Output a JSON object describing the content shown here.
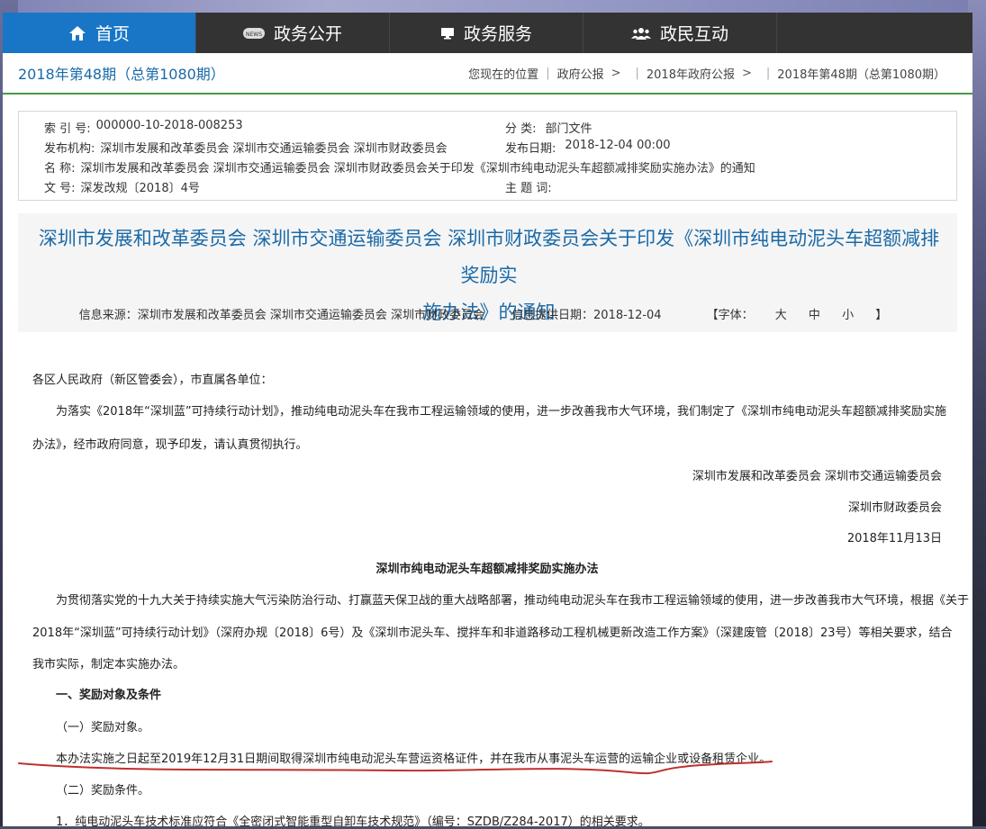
{
  "nav": {
    "items": [
      {
        "label": "首页",
        "icon": "home-icon"
      },
      {
        "label": "政务公开",
        "icon": "news-icon"
      },
      {
        "label": "政务服务",
        "icon": "monitor-icon"
      },
      {
        "label": "政民互动",
        "icon": "users-icon"
      }
    ],
    "news_badge": "NEWS"
  },
  "issue": "2018年第48期（总第1080期）",
  "breadcrumb": {
    "location_label": "您现在的位置",
    "items": [
      "政府公报",
      "2018年政府公报",
      "2018年第48期（总第1080期）"
    ],
    "separator": ">"
  },
  "info": {
    "index_label": "索 引 号:",
    "index_value": "000000-10-2018-008253",
    "category_label": "分 类:",
    "category_value": "部门文件",
    "org_label": "发布机构:",
    "org_value": "深圳市发展和改革委员会 深圳市交通运输委员会 深圳市财政委员会",
    "date_label": "发布日期:",
    "date_value": "2018-12-04 00:00",
    "name_label": "名 称:",
    "name_value": "深圳市发展和改革委员会 深圳市交通运输委员会 深圳市财政委员会关于印发《深圳市纯电动泥头车超额减排奖励实施办法》的通知",
    "docno_label": "文 号:",
    "docno_value": "深发改规〔2018〕4号",
    "keywords_label": "主 题 词:",
    "keywords_value": ""
  },
  "title": {
    "line1": "深圳市发展和改革委员会 深圳市交通运输委员会 深圳市财政委员会关于印发《深圳市纯电动泥头车超额减排奖励实",
    "line2": "施办法》的通知"
  },
  "meta": {
    "source": "信息来源：深圳市发展和改革委员会 深圳市交通运输委员会 深圳市财政委员会",
    "provided": "信息提供日期：2018-12-04",
    "font_open": "【字体：",
    "font_large": "大",
    "font_medium": "中",
    "font_small": "小",
    "font_close": "】"
  },
  "body": {
    "salutation": "各区人民政府（新区管委会），市直属各单位：",
    "para1_line1": "为落实《2018年“深圳蓝”可持续行动计划》，推动纯电动泥头车在我市工程运输领域的使用，进一步改善我市大气环境，我们制定了《深圳市纯电动泥头车超额减排奖励实施",
    "para1_line2": "办法》，经市政府同意，现予印发，请认真贯彻执行。",
    "sign1": "深圳市发展和改革委员会   深圳市交通运输委员会",
    "sign2": "深圳市财政委员会",
    "sign_date": "2018年11月13日",
    "doc_title": "深圳市纯电动泥头车超额减排奖励实施办法",
    "para2_line1": "为贯彻落实党的十九大关于持续实施大气污染防治行动、打赢蓝天保卫战的重大战略部署，推动纯电动泥头车在我市工程运输领域的使用，进一步改善我市大气环境，根据《关于",
    "para2_line2": "2018年“深圳蓝”可持续行动计划》（深府办规〔2018〕6号）及《深圳市泥头车、搅拌车和非道路移动工程机械更新改造工作方案》（深建废管〔2018〕23号）等相关要求，结合",
    "para2_line3": "我市实际，制定本实施办法。",
    "section1": "一、奖励对象及条件",
    "sub1": "（一）奖励对象。",
    "sub1_text": "本办法实施之日起至2019年12月31日期间取得深圳市纯电动泥头车营运资格证件，并在我市从事泥头车运营的运输企业或设备租赁企业。",
    "sub2": "（二）奖励条件。",
    "item1": "1．纯电动泥头车技术标准应符合《全密闭式智能重型自卸车技术规范》（编号：SZDB/Z284-2017）的相关要求。"
  },
  "colors": {
    "nav_bg": "#333333",
    "nav_active": "#1976c6",
    "title_blue": "#1a6aa8",
    "green_rule": "#4a9a42",
    "annotation_red": "#c0302c"
  }
}
